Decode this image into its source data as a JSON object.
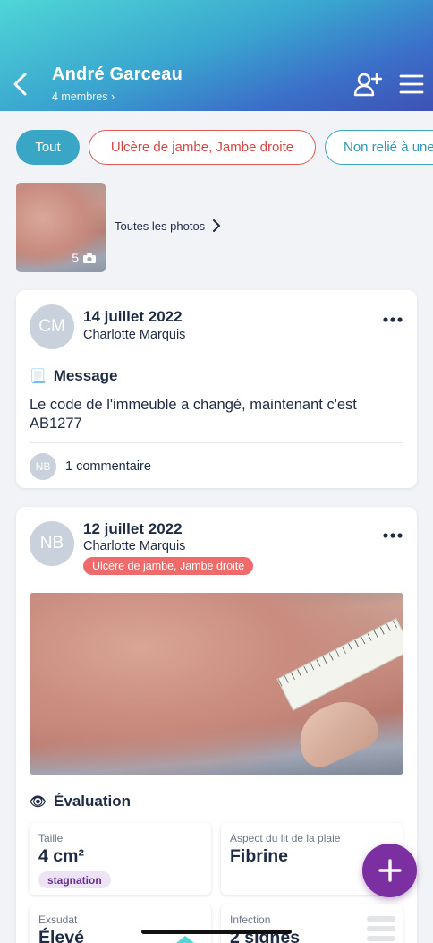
{
  "header": {
    "title": "André Garceau",
    "members": "4 membres ›"
  },
  "filters": {
    "all": "Tout",
    "ulcer": "Ulcère de jambe, Jambe droite",
    "unlinked": "Non relié à une"
  },
  "gallery": {
    "count": "5",
    "all_photos": "Toutes les photos"
  },
  "posts": [
    {
      "initials": "CM",
      "date": "14 juillet 2022",
      "author": "Charlotte Marquis",
      "section_icon": "scroll-emoji",
      "section_glyph": "📃",
      "section": "Message",
      "text": "Le code de l'immeuble a changé, maintenant c'est AB1277",
      "commenter_initials": "NB",
      "comments": "1 commentaire"
    },
    {
      "initials": "NB",
      "date": "12 juillet 2022",
      "author": "Charlotte Marquis",
      "tag": "Ulcère de jambe, Jambe droite",
      "section_icon": "eye-emoji",
      "section_glyph": "👁",
      "section": "Évaluation",
      "metrics": [
        {
          "label": "Taille",
          "value": "4 cm²",
          "badge": "stagnation"
        },
        {
          "label": "Aspect du lit de la plaie",
          "value": "Fibrine"
        },
        {
          "label": "Exsudat",
          "value": "Élevé"
        },
        {
          "label": "Infection",
          "value": "2 signes"
        }
      ]
    }
  ],
  "colors": {
    "accent": "#3aa6c5",
    "danger": "#ef6b6b",
    "fab": "#7b2fa1",
    "badge_text": "#6a2c91"
  }
}
